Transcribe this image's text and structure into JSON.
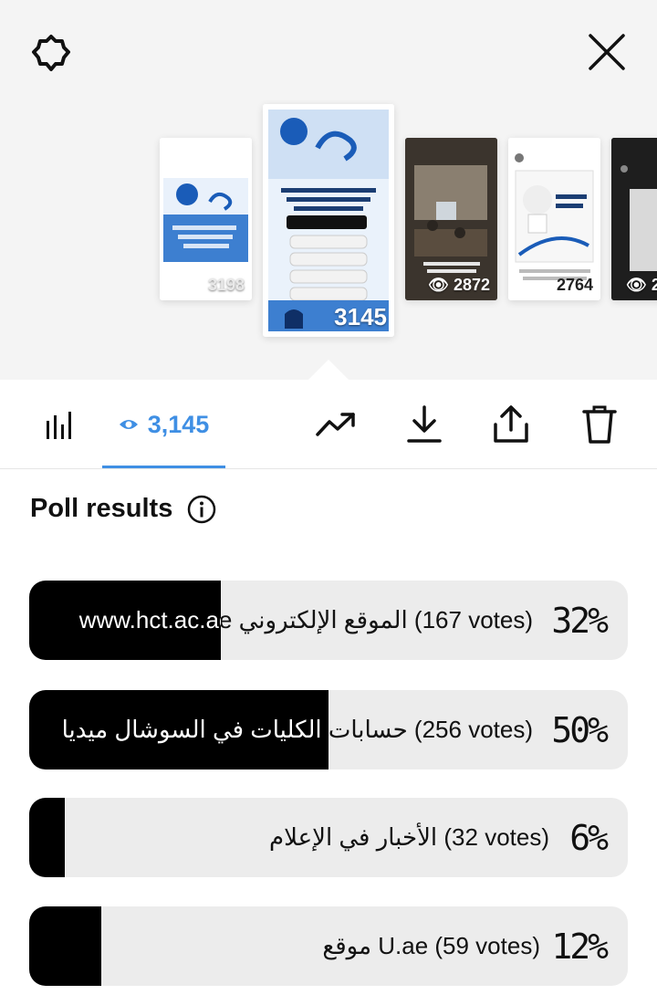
{
  "header": {
    "settings_icon": "gear-icon",
    "close_icon": "close-icon"
  },
  "thumbnails": [
    {
      "count": "3198"
    },
    {
      "count": "3145"
    },
    {
      "count": "2872"
    },
    {
      "count": "2764"
    },
    {
      "count": "2"
    }
  ],
  "toolbar": {
    "views": "3,145",
    "icons": [
      "bar-chart-icon",
      "eye-icon",
      "trending-icon",
      "download-icon",
      "share-icon",
      "trash-icon"
    ]
  },
  "poll": {
    "title": "Poll results",
    "options": [
      {
        "label": "www.hct.ac.ae الموقع الإلكتروني (167 votes)",
        "pct_label": "32%",
        "fill": 0.32
      },
      {
        "label": "حسابات الكليات في السوشال ميديا (256 votes)",
        "pct_label": "50%",
        "fill": 0.5
      },
      {
        "label": "الأخبار في الإعلام (32 votes)",
        "pct_label": "6%",
        "fill": 0.06
      },
      {
        "label": "موقع U.ae (59 votes)",
        "pct_label": "12%",
        "fill": 0.12
      }
    ]
  },
  "colors": {
    "accent": "#3f8fe4",
    "bar_bg": "#ececec",
    "bar_fill": "#000000"
  }
}
